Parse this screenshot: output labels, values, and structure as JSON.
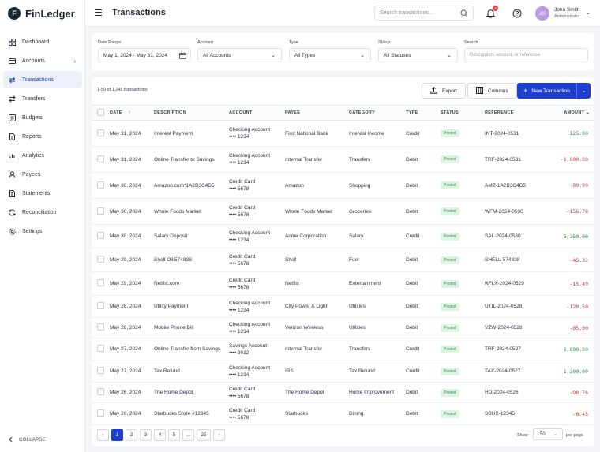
{
  "app": {
    "name": "FinLedger",
    "logo_letter": "F"
  },
  "sidebar": {
    "items": [
      {
        "label": "Dashboard",
        "icon": "dashboard-icon"
      },
      {
        "label": "Accounts",
        "icon": "accounts-icon",
        "has_chevron": true
      },
      {
        "label": "Transactions",
        "icon": "transactions-icon",
        "active": true
      },
      {
        "label": "Transfers",
        "icon": "transfers-icon"
      },
      {
        "label": "Budgets",
        "icon": "budgets-icon"
      },
      {
        "label": "Reports",
        "icon": "reports-icon"
      },
      {
        "label": "Analytics",
        "icon": "analytics-icon"
      },
      {
        "label": "Payees",
        "icon": "payees-icon"
      },
      {
        "label": "Statements",
        "icon": "statements-icon"
      },
      {
        "label": "Reconciliation",
        "icon": "reconciliation-icon"
      },
      {
        "label": "Settings",
        "icon": "settings-icon"
      }
    ],
    "collapse_label": "COLLAPSE"
  },
  "topbar": {
    "title": "Transactions",
    "search_placeholder": "Search transactions...",
    "notification_count": "3",
    "user": {
      "initials": "JS",
      "name": "John Smith",
      "role": "Administrator"
    }
  },
  "filters": {
    "date_range": {
      "label": "Date Range",
      "value": "May 1, 2024 - May 31, 2024"
    },
    "account": {
      "label": "Account",
      "value": "All Accounts"
    },
    "type": {
      "label": "Type",
      "value": "All Types"
    },
    "status": {
      "label": "Status",
      "value": "All Statuses"
    },
    "search": {
      "label": "Search",
      "placeholder": "Description, amount, or reference"
    }
  },
  "table": {
    "count_text": "1-50 of 1,248 transactions",
    "export_label": "Export",
    "columns_label": "Columns",
    "new_label": "New Transaction",
    "headers": {
      "date": "DATE",
      "description": "DESCRIPTION",
      "account": "ACCOUNT",
      "payee": "PAYEE",
      "category": "CATEGORY",
      "type": "TYPE",
      "status": "STATUS",
      "reference": "REFERENCE",
      "amount": "AMOUNT"
    },
    "rows": [
      {
        "date": "May 31, 2024",
        "description": "Interest Payment",
        "account": "Checking Account",
        "acct_no": "•••• 1234",
        "payee": "First National Bank",
        "category": "Interest Income",
        "type": "Credit",
        "status": "Posted",
        "reference": "INT-2024-0531",
        "amount": "125.00",
        "sign": "pos"
      },
      {
        "date": "May 31, 2024",
        "description": "Online Transfer to Savings",
        "account": "Checking Account",
        "acct_no": "•••• 1234",
        "payee": "Internal Transfer",
        "category": "Transfers",
        "type": "Debit",
        "status": "Posted",
        "reference": "TRF-2024-0531",
        "amount": "-1,000.00",
        "sign": "neg"
      },
      {
        "date": "May 30, 2024",
        "description": "Amazon.com*1A2B3C4D5",
        "account": "Credit Card",
        "acct_no": "•••• 5678",
        "payee": "Amazon",
        "category": "Shopping",
        "type": "Debit",
        "status": "Posted",
        "reference": "AMZ-1A2B3C4D5",
        "amount": "-89.99",
        "sign": "neg"
      },
      {
        "date": "May 30, 2024",
        "description": "Whole Foods Market",
        "account": "Credit Card",
        "acct_no": "•••• 5678",
        "payee": "Whole Foods Market",
        "category": "Groceries",
        "type": "Debit",
        "status": "Posted",
        "reference": "WFM-2024-0530",
        "amount": "-156.78",
        "sign": "neg"
      },
      {
        "date": "May 30, 2024",
        "description": "Salary Deposit",
        "account": "Checking Account",
        "acct_no": "•••• 1234",
        "payee": "Acme Corporation",
        "category": "Salary",
        "type": "Credit",
        "status": "Posted",
        "reference": "SAL-2024-0530",
        "amount": "5,250.00",
        "sign": "pos"
      },
      {
        "date": "May 29, 2024",
        "description": "Shell Oil 574838",
        "account": "Credit Card",
        "acct_no": "•••• 5678",
        "payee": "Shell",
        "category": "Fuel",
        "type": "Debit",
        "status": "Posted",
        "reference": "SHELL-574838",
        "amount": "-45.32",
        "sign": "neg"
      },
      {
        "date": "May 29, 2024",
        "description": "Netflix.com",
        "account": "Credit Card",
        "acct_no": "•••• 5678",
        "payee": "Netflix",
        "category": "Entertainment",
        "type": "Debit",
        "status": "Posted",
        "reference": "NFLX-2024-0529",
        "amount": "-15.49",
        "sign": "neg"
      },
      {
        "date": "May 28, 2024",
        "description": "Utility Payment",
        "account": "Checking Account",
        "acct_no": "•••• 1234",
        "payee": "City Power & Light",
        "category": "Utilities",
        "type": "Debit",
        "status": "Posted",
        "reference": "UTIL-2024-0528",
        "amount": "-120.50",
        "sign": "neg"
      },
      {
        "date": "May 28, 2024",
        "description": "Mobile Phone Bill",
        "account": "Checking Account",
        "acct_no": "•••• 1234",
        "payee": "Verizon Wireless",
        "category": "Utilities",
        "type": "Debit",
        "status": "Posted",
        "reference": "VZW-2024-0528",
        "amount": "-85.00",
        "sign": "neg"
      },
      {
        "date": "May 27, 2024",
        "description": "Online Transfer from Savings",
        "account": "Savings Account",
        "acct_no": "•••• 9012",
        "payee": "Internal Transfer",
        "category": "Transfers",
        "type": "Credit",
        "status": "Posted",
        "reference": "TRF-2024-0527",
        "amount": "1,000.00",
        "sign": "pos"
      },
      {
        "date": "May 27, 2024",
        "description": "Tax Refund",
        "account": "Checking Account",
        "acct_no": "•••• 1234",
        "payee": "IRS",
        "category": "Tax Refund",
        "type": "Credit",
        "status": "Posted",
        "reference": "TAX-2024-0527",
        "amount": "1,200.00",
        "sign": "pos"
      },
      {
        "date": "May 26, 2024",
        "description": "The Home Depot",
        "account": "Credit Card",
        "acct_no": "•••• 5678",
        "payee": "The Home Depot",
        "category": "Home Improvement",
        "type": "Debit",
        "status": "Posted",
        "reference": "HD-2024-0526",
        "amount": "-98.76",
        "sign": "neg"
      },
      {
        "date": "May 26, 2024",
        "description": "Starbucks Store #12345",
        "account": "Credit Card",
        "acct_no": "•••• 5678",
        "payee": "Starbucks",
        "category": "Dining",
        "type": "Debit",
        "status": "Posted",
        "reference": "SBUX-12345",
        "amount": "-6.45",
        "sign": "neg"
      }
    ]
  },
  "pagination": {
    "pages": [
      "1",
      "2",
      "3",
      "4",
      "5",
      "...",
      "25"
    ],
    "current": "1",
    "show_label": "Show",
    "per_page_value": "50",
    "per_page_label": "per page"
  },
  "colors": {
    "primary": "#1e3fd0",
    "positive": "#1f8f3a",
    "negative": "#c23b3b",
    "posted_bg": "#dff3e5"
  }
}
